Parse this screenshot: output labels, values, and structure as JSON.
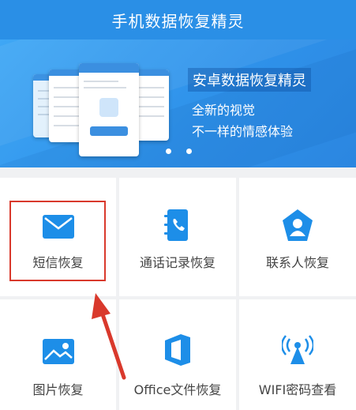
{
  "header": {
    "title": "手机数据恢复精灵"
  },
  "banner": {
    "title": "安卓数据恢复精灵",
    "subtitle_1": "全新的视觉",
    "subtitle_2": "不一样的情感体验",
    "carousel_pages": 2
  },
  "grid": {
    "items": [
      {
        "label": "短信恢复",
        "icon": "envelope-icon"
      },
      {
        "label": "通话记录恢复",
        "icon": "call-log-icon"
      },
      {
        "label": "联系人恢复",
        "icon": "contact-icon"
      },
      {
        "label": "图片恢复",
        "icon": "image-icon"
      },
      {
        "label": "Office文件恢复",
        "icon": "office-icon"
      },
      {
        "label": "WIFI密码查看",
        "icon": "wifi-signal-icon"
      }
    ]
  },
  "colors": {
    "primary": "#2a8fe6",
    "icon_blue": "#1d8ee8",
    "annotation_red": "#d9392c"
  }
}
